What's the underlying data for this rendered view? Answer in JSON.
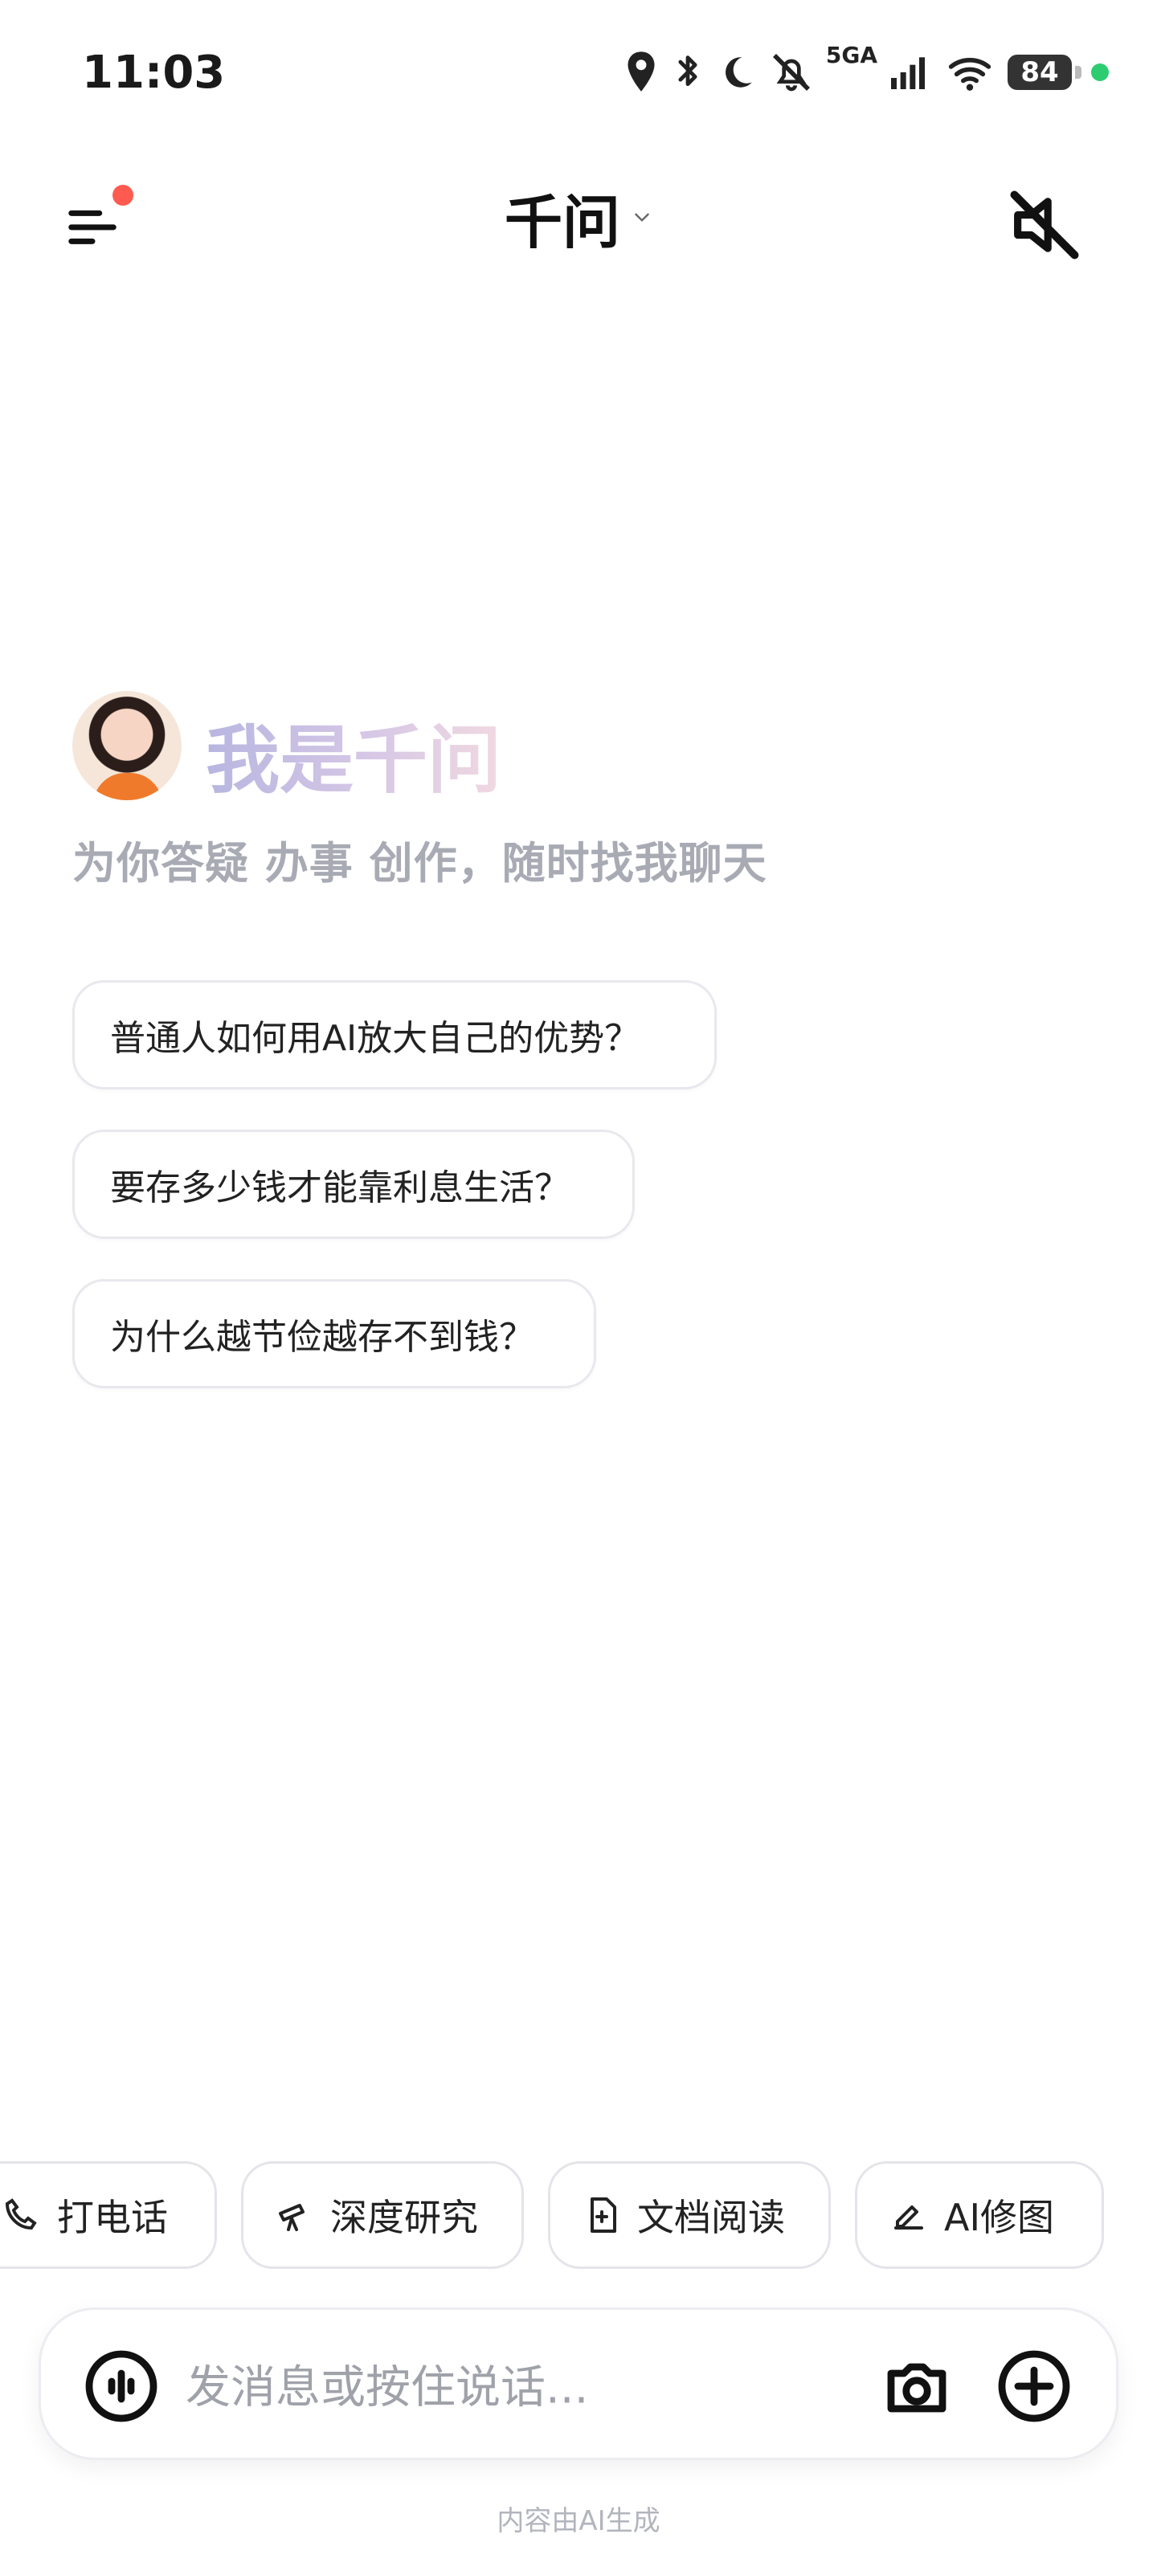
{
  "status_bar": {
    "time": "11:03",
    "network": "5GA",
    "battery": "84",
    "icons": [
      "location-icon",
      "bluetooth-icon",
      "moon-icon",
      "bell-off-icon",
      "signal-icon",
      "wifi-icon",
      "battery-icon"
    ]
  },
  "header": {
    "title": "千问",
    "notification_dot_color": "#ff5a4f"
  },
  "intro": {
    "greeting": "我是千问",
    "subtitle": "为你答疑 办事 创作，随时找我聊天"
  },
  "suggestions": [
    "普通人如何用AI放大自己的优势？",
    "要存多少钱才能靠利息生活？",
    "为什么越节俭越存不到钱？"
  ],
  "tools": [
    {
      "label": "打电话",
      "icon": "phone-icon"
    },
    {
      "label": "深度研究",
      "icon": "telescope-icon"
    },
    {
      "label": "文档阅读",
      "icon": "document-icon"
    },
    {
      "label": "AI修图",
      "icon": "edit-image-icon"
    }
  ],
  "input": {
    "placeholder": "发消息或按住说话..."
  },
  "footer": {
    "note": "内容由AI生成"
  }
}
